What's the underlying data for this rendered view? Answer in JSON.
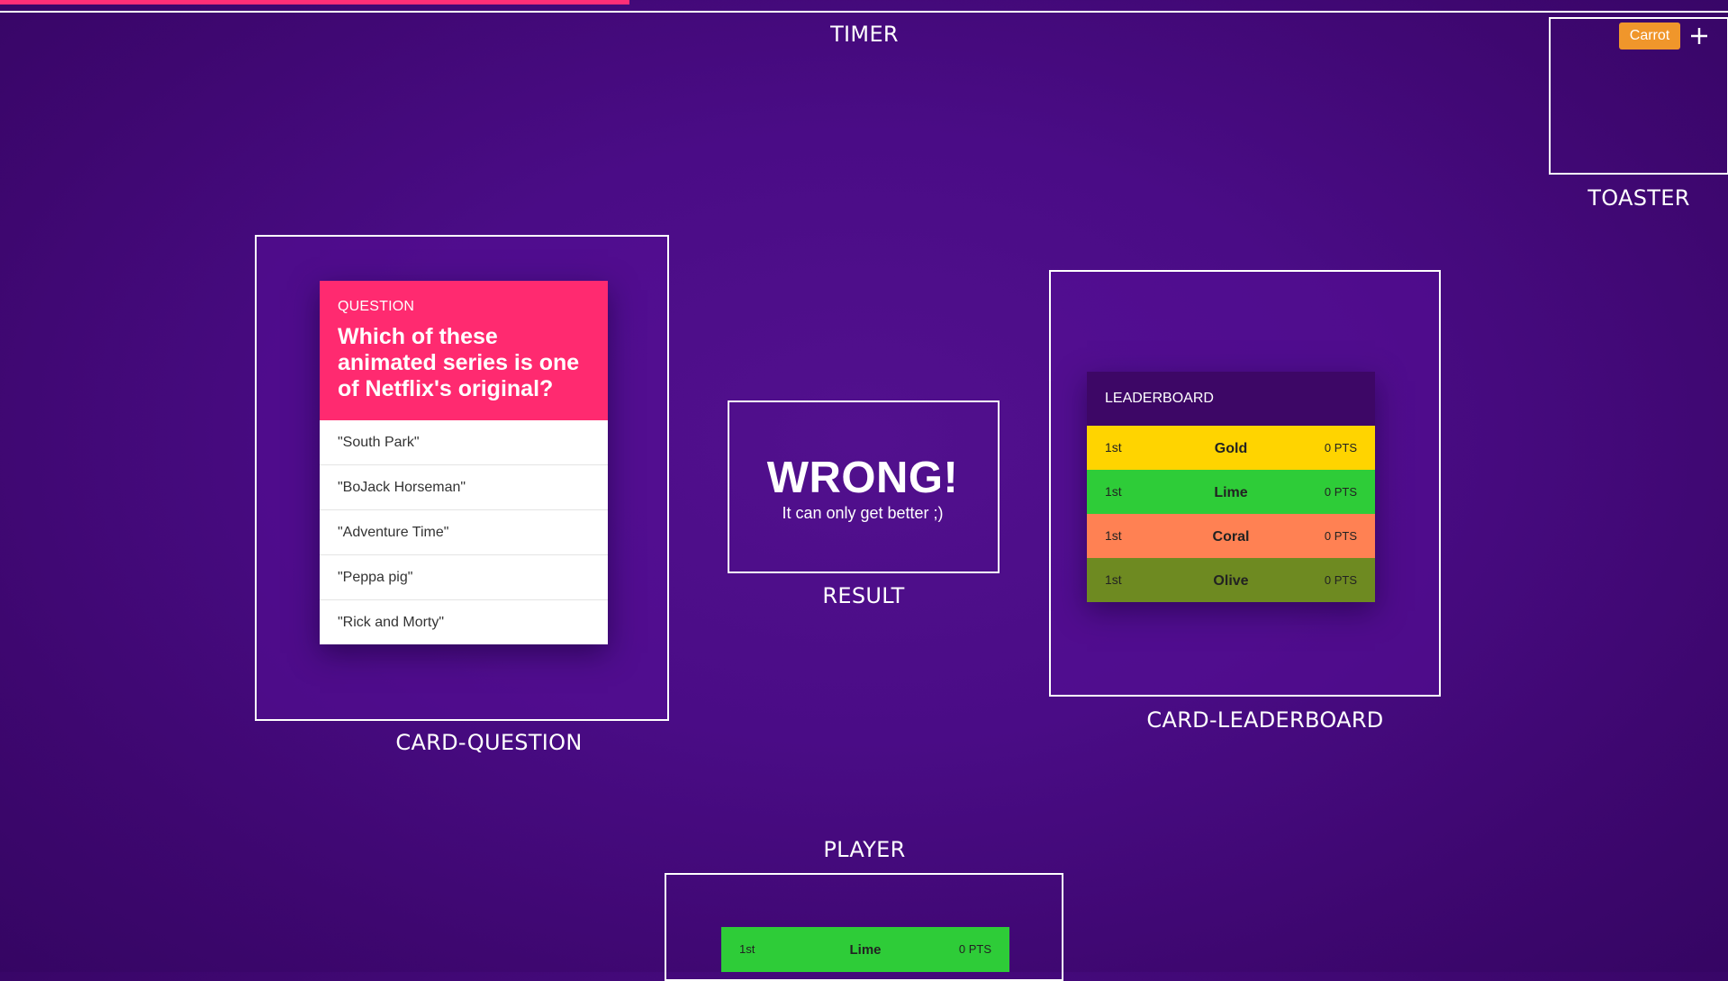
{
  "timer": {
    "label": "TIMER",
    "progress": 0.364,
    "bar_color": "#ff2e77"
  },
  "toaster": {
    "label": "TOASTER",
    "chip_text": "Carrot",
    "chip_color": "#f0962b",
    "add_icon": "plus-icon"
  },
  "card_question": {
    "label": "CARD-QUESTION",
    "kicker": "QUESTION",
    "title": "Which of these animated series is one of Netflix's original?",
    "header_color": "#ff2a70",
    "options": [
      "\"South Park\"",
      "\"BoJack Horseman\"",
      "\"Adventure Time\"",
      "\"Peppa pig\"",
      "\"Rick and Morty\""
    ]
  },
  "result": {
    "label": "RESULT",
    "title": "WRONG!",
    "subtitle": "It can only get better ;)"
  },
  "card_leaderboard": {
    "label": "CARD-LEADERBOARD",
    "title": "LEADERBOARD",
    "rows": [
      {
        "rank": "1st",
        "name": "Gold",
        "points": "0 PTS",
        "color": "#ffd400"
      },
      {
        "rank": "1st",
        "name": "Lime",
        "points": "0 PTS",
        "color": "#2ecc38"
      },
      {
        "rank": "1st",
        "name": "Coral",
        "points": "0 PTS",
        "color": "#ff8153"
      },
      {
        "rank": "1st",
        "name": "Olive",
        "points": "0 PTS",
        "color": "#6e8a21"
      }
    ]
  },
  "player": {
    "label": "PLAYER",
    "rank": "1st",
    "name": "Lime",
    "points": "0 PTS",
    "color": "#2ecc38"
  }
}
